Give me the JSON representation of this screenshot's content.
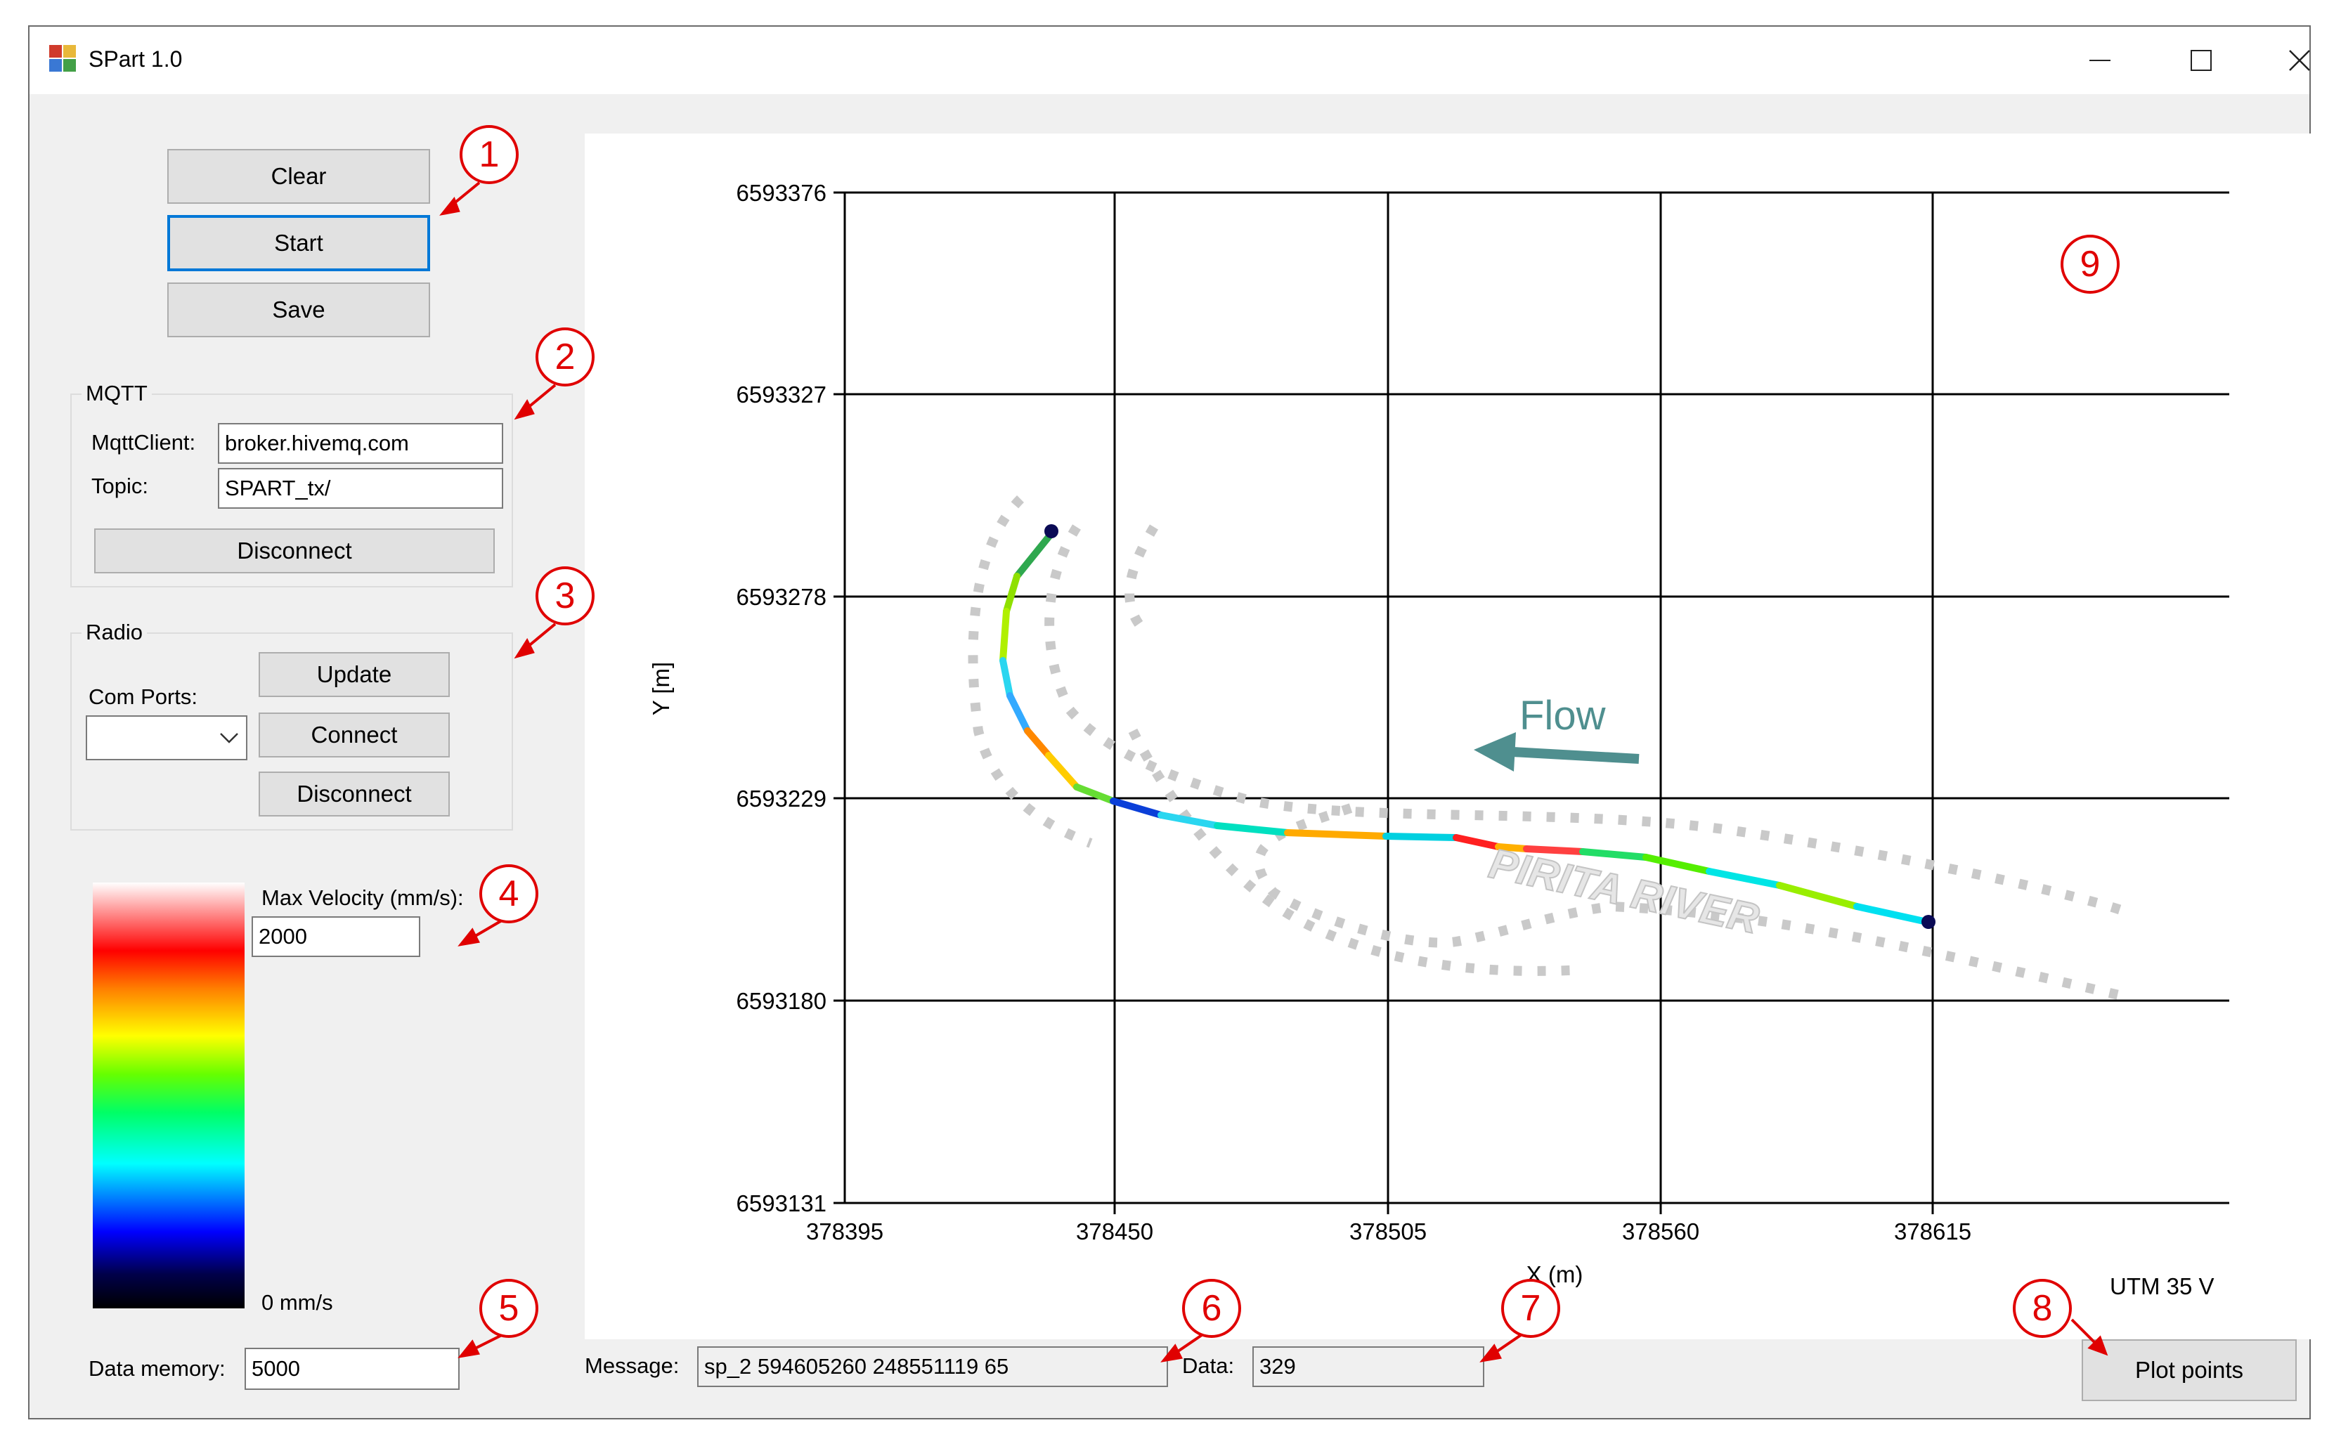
{
  "window": {
    "title": "SPart 1.0"
  },
  "controls": {
    "clear": "Clear",
    "start": "Start",
    "save": "Save"
  },
  "mqtt": {
    "group_title": "MQTT",
    "client_label": "MqttClient:",
    "client_value": "broker.hivemq.com",
    "topic_label": "Topic:",
    "topic_value": "SPART_tx/",
    "disconnect": "Disconnect"
  },
  "radio": {
    "group_title": "Radio",
    "com_ports_label": "Com Ports:",
    "com_ports_value": "",
    "update": "Update",
    "connect": "Connect",
    "disconnect": "Disconnect"
  },
  "velocity": {
    "max_label": "Max Velocity (mm/s):",
    "max_value": "2000",
    "min_label": "0 mm/s"
  },
  "memory": {
    "label": "Data memory:",
    "value": "5000"
  },
  "status": {
    "message_label": "Message:",
    "message_value": "sp_2 594605260 248551119 65",
    "data_label": "Data:",
    "data_value": "329"
  },
  "plot_button": "Plot points",
  "callouts": [
    "1",
    "2",
    "3",
    "4",
    "5",
    "6",
    "7",
    "8",
    "9"
  ],
  "plot": {
    "y_ticks": [
      "6593376",
      "6593327",
      "6593278",
      "6593229",
      "6593180",
      "6593131"
    ],
    "x_ticks": [
      "378395",
      "378450",
      "378505",
      "378560",
      "378615"
    ],
    "xlabel": "X (m)",
    "ylabel": "Y [m]",
    "zone": "UTM 35 V",
    "flow_label": "Flow",
    "river_label": "PIRITA RIVER",
    "flow_color": "#4f8f8f",
    "xlim": [
      378395,
      378670
    ],
    "ylim": [
      6593131,
      6593376
    ]
  },
  "colors": {
    "accent": "#0078d7",
    "callout": "#e00000"
  }
}
